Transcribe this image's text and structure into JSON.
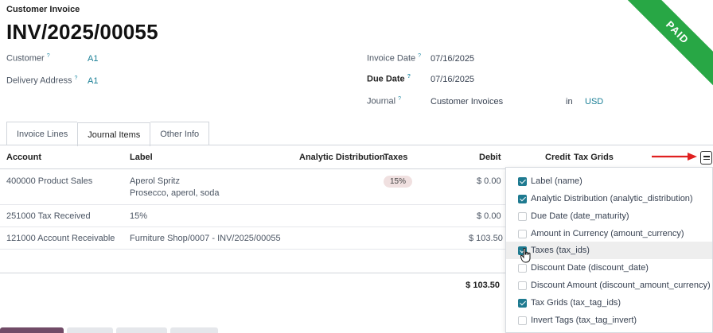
{
  "header": {
    "doc_type": "Customer Invoice",
    "title": "INV/2025/00055",
    "status_ribbon": "PAID"
  },
  "fields": {
    "customer_label": "Customer",
    "customer_value": "A1",
    "delivery_label": "Delivery Address",
    "delivery_value": "A1",
    "invoice_date_label": "Invoice Date",
    "invoice_date_value": "07/16/2025",
    "due_date_label": "Due Date",
    "due_date_value": "07/16/2025",
    "journal_label": "Journal",
    "journal_value": "Customer Invoices",
    "in_text": "in",
    "currency_value": "USD",
    "help_mark": "?"
  },
  "tabs": [
    {
      "label": "Invoice Lines"
    },
    {
      "label": "Journal Items"
    },
    {
      "label": "Other Info"
    }
  ],
  "table": {
    "columns": {
      "account": "Account",
      "label": "Label",
      "analytic": "Analytic Distribution",
      "taxes": "Taxes",
      "debit": "Debit",
      "credit": "Credit",
      "tax_grids": "Tax Grids"
    },
    "rows": [
      {
        "account": "400000 Product Sales",
        "label": "Aperol Spritz",
        "label2": "Prosecco, aperol, soda",
        "tax": "15%",
        "debit": "$ 0.00"
      },
      {
        "account": "251000 Tax Received",
        "label": "15%",
        "debit": "$ 0.00"
      },
      {
        "account": "121000 Account Receivable",
        "label": "Furniture Shop/0007 - INV/2025/00055",
        "debit": "$ 103.50"
      }
    ],
    "total_debit": "$ 103.50"
  },
  "column_menu": {
    "options": [
      {
        "label": "Label (name)",
        "checked": true
      },
      {
        "label": "Analytic Distribution (analytic_distribution)",
        "checked": true
      },
      {
        "label": "Due Date (date_maturity)",
        "checked": false
      },
      {
        "label": "Amount in Currency (amount_currency)",
        "checked": false
      },
      {
        "label": "Taxes (tax_ids)",
        "checked": true
      },
      {
        "label": "Discount Date (discount_date)",
        "checked": false
      },
      {
        "label": "Discount Amount (discount_amount_currency)",
        "checked": false
      },
      {
        "label": "Tax Grids (tax_tag_ids)",
        "checked": true
      },
      {
        "label": "Invert Tags (tax_tag_invert)",
        "checked": false
      }
    ]
  },
  "colors": {
    "accent": "#1e7a90",
    "ribbon": "#28a745",
    "annotation_arrow": "#e02020"
  }
}
